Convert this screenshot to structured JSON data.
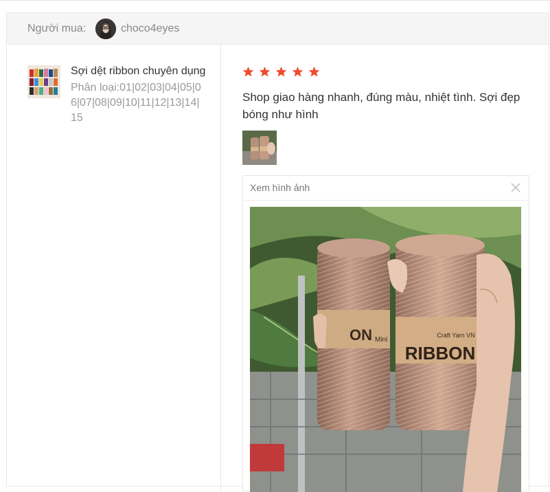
{
  "review": {
    "buyer_label": "Người mua:",
    "buyer_name": "choco4eyes",
    "product": {
      "title": "Sợi dệt ribbon chuyên dụng",
      "variant": "Phân loại:01|02|03|04|05|06|07|08|09|10|11|12|13|14|15"
    },
    "rating": 5,
    "text": "Shop giao hàng nhanh, đúng màu, nhiệt tình. Sợi đẹp bóng như hình"
  },
  "viewer": {
    "title": "Xem hình ảnh",
    "photo_labels": {
      "left_spool": "ON",
      "left_spool_sub": "Mini",
      "right_spool_brand": "Craft Yarn VN",
      "right_spool": "RIBBON"
    }
  },
  "colors": {
    "star": "#ee4d2d",
    "header_bg": "#f5f5f5",
    "muted_text": "#888888"
  }
}
